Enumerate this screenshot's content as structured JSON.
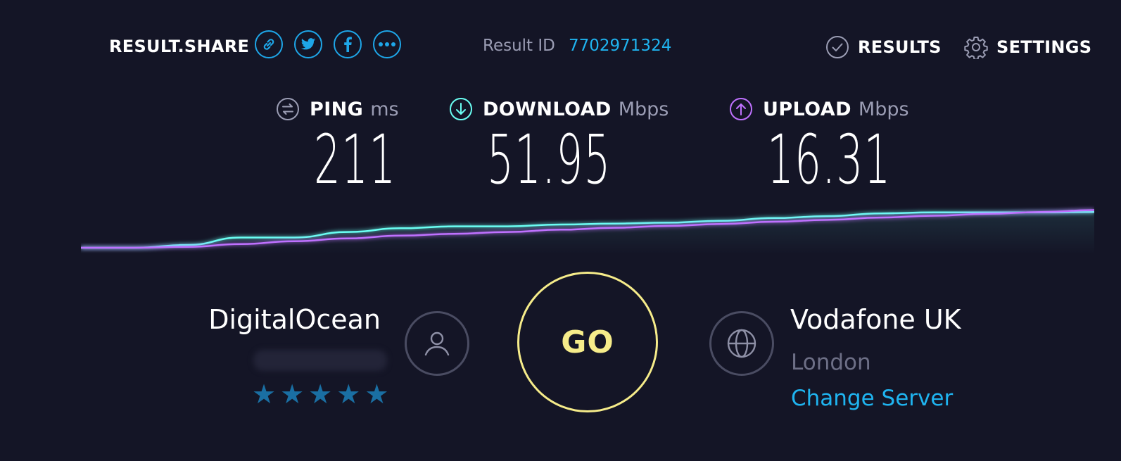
{
  "header": {
    "share_label": "RESULT.SHARE",
    "share_buttons": [
      {
        "icon": "link-icon"
      },
      {
        "icon": "twitter-icon"
      },
      {
        "icon": "facebook-icon"
      },
      {
        "icon": "more-icon"
      }
    ],
    "result_id_label": "Result ID",
    "result_id_value": "7702971324",
    "results_label": "RESULTS",
    "settings_label": "SETTINGS"
  },
  "metrics": {
    "ping": {
      "name": "PING",
      "unit": "ms",
      "value": "211",
      "color": "#9b9db4",
      "icon": "ping-icon"
    },
    "download": {
      "name": "DOWNLOAD",
      "unit": "Mbps",
      "value": "51.95",
      "color": "#6afff3",
      "icon": "download-icon"
    },
    "upload": {
      "name": "UPLOAD",
      "unit": "Mbps",
      "value": "16.31",
      "color": "#bf71ff",
      "icon": "upload-icon"
    }
  },
  "graph": {
    "download_series": [
      0,
      0,
      0.6,
      2.2,
      2.2,
      3.4,
      4.2,
      4.6,
      4.6,
      5.0,
      5.2,
      5.4,
      5.8,
      6.4,
      6.8,
      7.4,
      7.6,
      7.6,
      7.6,
      7.7
    ],
    "upload_series": [
      0,
      0,
      0.2,
      0.8,
      1.4,
      2.0,
      2.6,
      3.0,
      3.4,
      3.9,
      4.3,
      4.7,
      5.1,
      5.6,
      6.0,
      6.5,
      6.9,
      7.3,
      7.7,
      8.1
    ],
    "download_color": "#6afff3",
    "upload_color": "#bf71ff"
  },
  "provider": {
    "isp_name": "DigitalOcean",
    "rating_stars": 5,
    "icon": "user-icon"
  },
  "go_label": "GO",
  "server": {
    "name": "Vodafone UK",
    "city": "London",
    "change_label": "Change Server",
    "icon": "globe-icon"
  }
}
